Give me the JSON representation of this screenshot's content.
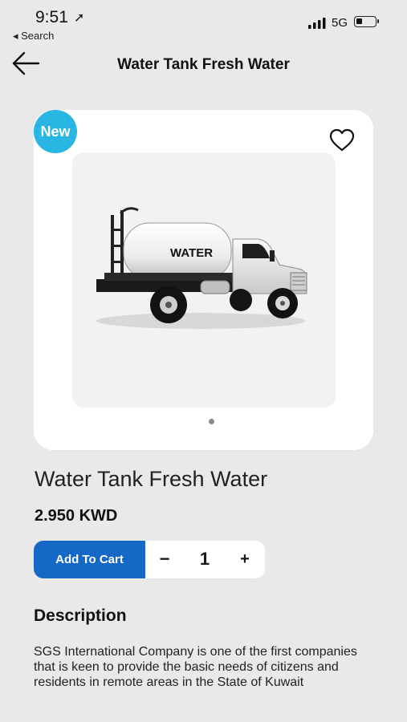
{
  "status_bar": {
    "time": "9:51",
    "location_glyph": "➚",
    "back_app": "◂ Search",
    "network": "5G"
  },
  "nav": {
    "title": "Water Tank Fresh Water",
    "back_icon": "arrow-left-icon"
  },
  "product": {
    "badge": "New",
    "image_text": "WATER",
    "title": "Water Tank Fresh Water",
    "price": "2.950 KWD",
    "favorite_icon": "heart-outline-icon"
  },
  "cart": {
    "add_label": "Add To Cart",
    "minus": "−",
    "quantity": "1",
    "plus": "+"
  },
  "description": {
    "heading": "Description",
    "text": "SGS International Company is one of the first companies that is keen to provide the basic needs of citizens and residents in remote areas in the State of Kuwait"
  },
  "colors": {
    "primary": "#1668c7",
    "badge": "#29b6e3",
    "background": "#e9e9e9"
  }
}
